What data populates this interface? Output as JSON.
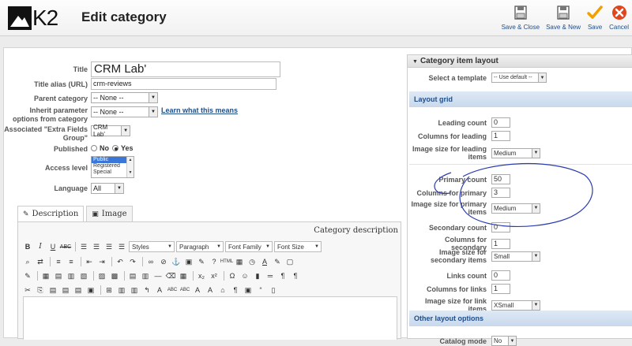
{
  "header": {
    "logo_text": "K2",
    "title": "Edit category",
    "toolbar": [
      {
        "label": "Save & Close",
        "icon": "save-close-icon"
      },
      {
        "label": "Save & New",
        "icon": "save-new-icon"
      },
      {
        "label": "Save",
        "icon": "checkmark-icon"
      },
      {
        "label": "Cancel",
        "icon": "cancel-icon"
      }
    ]
  },
  "form": {
    "title_label": "Title",
    "title_value": "CRM Lab'",
    "alias_label": "Title alias (URL)",
    "alias_value": "crm-reviews",
    "parent_label": "Parent category",
    "parent_value": "-- None --",
    "inherit_label": "Inherit parameter options from category",
    "inherit_value": "-- None --",
    "inherit_link": "Learn what this means",
    "extra_label": "Associated \"Extra Fields Group\"",
    "extra_value": "CRM Lab'",
    "published_label": "Published",
    "published_no": "No",
    "published_yes": "Yes",
    "access_label": "Access level",
    "access_options": [
      "Public",
      "Registered",
      "Special"
    ],
    "access_selected": "Public",
    "language_label": "Language",
    "language_value": "All"
  },
  "tabs": [
    {
      "label": "Description",
      "icon": "pencil-icon"
    },
    {
      "label": "Image",
      "icon": "image-icon"
    }
  ],
  "editor": {
    "title": "Category description",
    "styles": "Styles",
    "paragraph": "Paragraph",
    "font_family": "Font Family",
    "font_size": "Font Size"
  },
  "layout": {
    "panel_title": "Category item layout",
    "template_label": "Select a template",
    "template_value": "-- Use default --",
    "grid_title": "Layout grid",
    "leading_count_label": "Leading count",
    "leading_count": "0",
    "columns_leading_label": "Columns for leading",
    "columns_leading": "1",
    "image_leading_label": "Image size for leading items",
    "image_leading": "Medium",
    "primary_count_label": "Primary count",
    "primary_count": "50",
    "columns_primary_label": "Columns for primary",
    "columns_primary": "3",
    "image_primary_label": "Image size for primary items",
    "image_primary": "Medium",
    "secondary_count_label": "Secondary count",
    "secondary_count": "0",
    "columns_secondary_label": "Columns for secondary",
    "columns_secondary": "1",
    "image_secondary_label": "Image size for secondary items",
    "image_secondary": "Small",
    "links_count_label": "Links count",
    "links_count": "0",
    "columns_links_label": "Columns for links",
    "columns_links": "1",
    "image_links_label": "Image size for link items",
    "image_links": "XSmall",
    "other_title": "Other layout options",
    "catalog_label": "Catalog mode",
    "catalog_value": "No"
  },
  "colors": {
    "accent": "#1f4e88",
    "annotation": "#2b3bb0"
  }
}
